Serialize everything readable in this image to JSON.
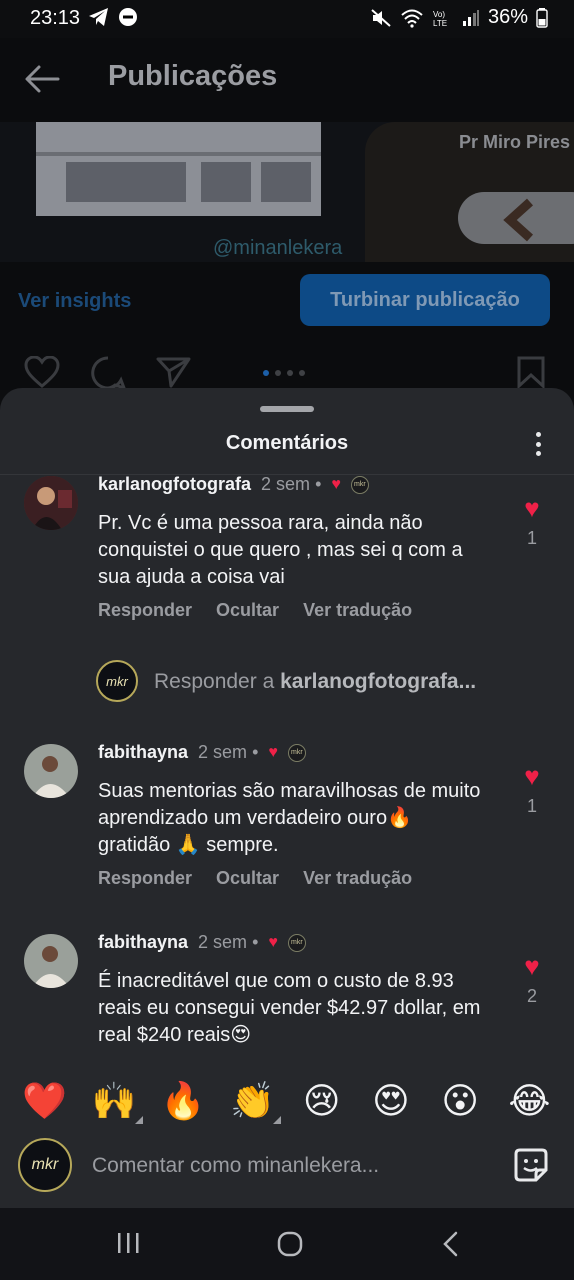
{
  "status_bar": {
    "time": "23:13",
    "battery": "36%"
  },
  "header": {
    "title": "Publicações"
  },
  "post": {
    "overlay_name": "Pr Miro Pires",
    "handle": "@minanlekera",
    "insights_label": "Ver insights",
    "boost_label": "Turbinar publicação"
  },
  "comments_sheet": {
    "title": "Comentários",
    "comments": [
      {
        "username": "karlanogfotografa",
        "time": "2 sem",
        "separator": "•",
        "text": "Pr. Vc é uma pessoa rara, ainda não conquistei o que quero , mas sei q com a sua ajuda a coisa vai",
        "like_count": "1",
        "reply_label": "Responder",
        "hide_label": "Ocultar",
        "translate_label": "Ver tradução"
      },
      {
        "username": "fabithayna",
        "time": "2 sem",
        "separator": "•",
        "text": "Suas mentorias são maravilhosas de muito aprendizado um verdadeiro ouro🔥 gratidão 🙏 sempre.",
        "like_count": "1",
        "reply_label": "Responder",
        "hide_label": "Ocultar",
        "translate_label": "Ver tradução"
      },
      {
        "username": "fabithayna",
        "time": "2 sem",
        "separator": "•",
        "text": "É inacreditável que com o custo de 8.93 reais eu consegui vender $42.97 dollar, em real $240 reais😍",
        "like_count": "2"
      }
    ],
    "reply_prompt": {
      "prefix": "Responder a",
      "target": "karlanogfotografa..."
    },
    "badge_text": "mkr"
  },
  "emoji_bar": {
    "emojis": [
      "❤️",
      "🙌",
      "🔥",
      "👏",
      "😢",
      "😍",
      "😮",
      "😂"
    ]
  },
  "comment_input": {
    "avatar_text": "mkr",
    "placeholder": "Comentar como minanlekera..."
  },
  "colors": {
    "sheet_bg": "#26282c",
    "heart": "#ef2148",
    "boost_button": "#0d4a86",
    "text_secondary": "#9a9ca1"
  }
}
